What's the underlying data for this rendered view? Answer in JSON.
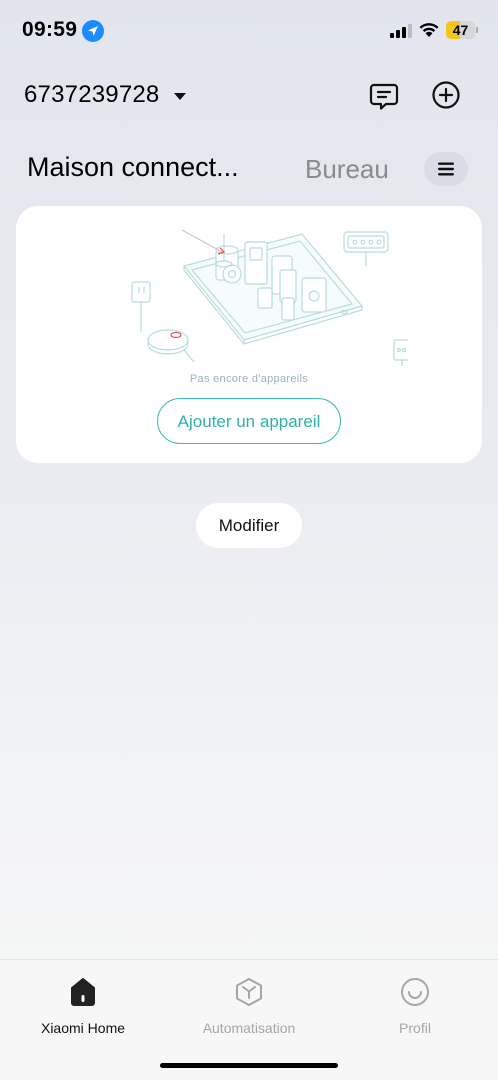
{
  "status_bar": {
    "time": "09:59",
    "battery_level": "47",
    "battery_fraction": 0.47,
    "icons": [
      "location-arrow-icon",
      "cellular-signal-icon",
      "wifi-icon",
      "battery-icon"
    ],
    "battery_color": "#f5c517"
  },
  "header": {
    "account_id": "6737239728",
    "icons": [
      "chevron-down-icon",
      "messages-icon",
      "add-circle-icon"
    ]
  },
  "home_tabs": {
    "active": "Maison connect...",
    "other": "Bureau",
    "menu_icon": "menu-icon"
  },
  "empty_state": {
    "message": "Pas encore d'appareils",
    "add_device_label": "Ajouter un appareil",
    "accent_color": "#3bbcb3"
  },
  "edit_label": "Modifier",
  "bottom_nav": {
    "items": [
      {
        "label": "Xiaomi Home",
        "icon": "home-icon",
        "active": true
      },
      {
        "label": "Automatisation",
        "icon": "automation-cube-icon",
        "active": false
      },
      {
        "label": "Profil",
        "icon": "profile-smile-icon",
        "active": false
      }
    ]
  }
}
